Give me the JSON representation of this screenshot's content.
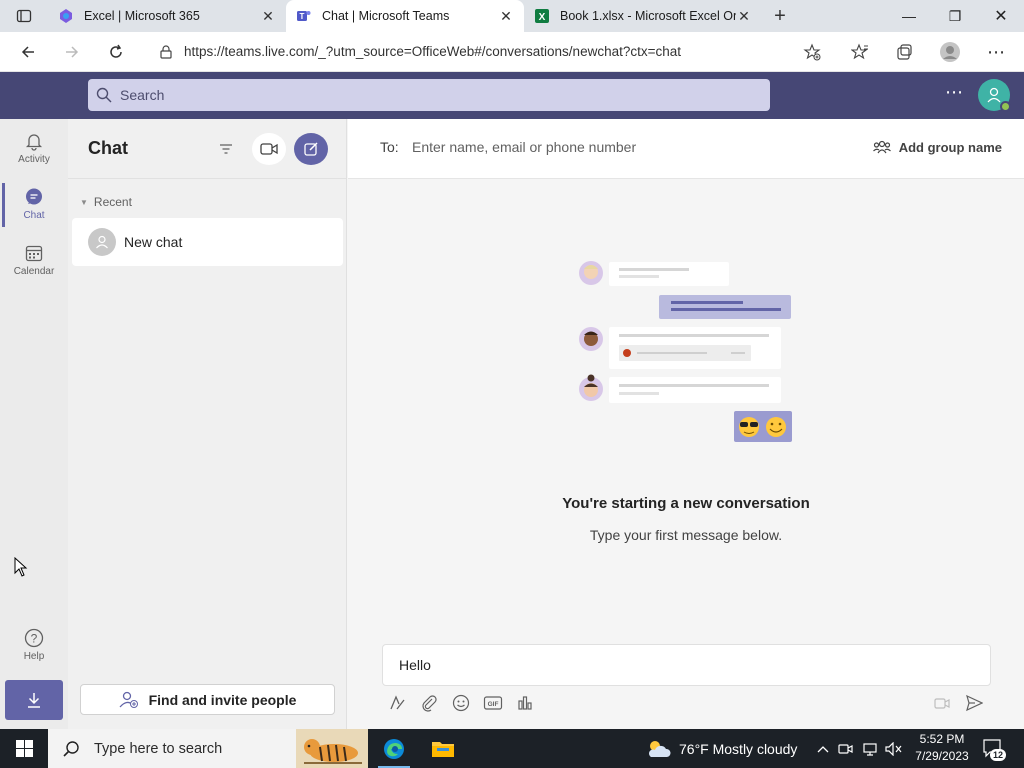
{
  "browser": {
    "tabs": [
      {
        "title": "Excel | Microsoft 365",
        "active": false
      },
      {
        "title": "Chat | Microsoft Teams",
        "active": true
      },
      {
        "title": "Book 1.xlsx - Microsoft Excel Onl",
        "active": false
      }
    ],
    "url": "https://teams.live.com/_?utm_source=OfficeWeb#/conversations/newchat?ctx=chat"
  },
  "teams": {
    "search_placeholder": "Search",
    "rail": [
      {
        "label": "Activity",
        "icon": "bell-icon"
      },
      {
        "label": "Chat",
        "icon": "chat-icon"
      },
      {
        "label": "Calendar",
        "icon": "calendar-icon"
      },
      {
        "label": "Help",
        "icon": "help-icon"
      }
    ],
    "chat_panel": {
      "title": "Chat",
      "section": "Recent",
      "items": [
        {
          "label": "New chat"
        }
      ],
      "invite_label": "Find and invite people"
    },
    "main": {
      "to_label": "To:",
      "to_placeholder": "Enter name, email or phone number",
      "group_name_label": "Add group name",
      "empty_title": "You're starting a new conversation",
      "empty_subtitle": "Type your first message below.",
      "compose_value": "Hello"
    },
    "colors": {
      "accent": "#6264a7",
      "header": "#464775"
    }
  },
  "taskbar": {
    "search_placeholder": "Type here to search",
    "weather": "76°F  Mostly cloudy",
    "time": "5:52 PM",
    "date": "7/29/2023",
    "notification_count": "12"
  }
}
